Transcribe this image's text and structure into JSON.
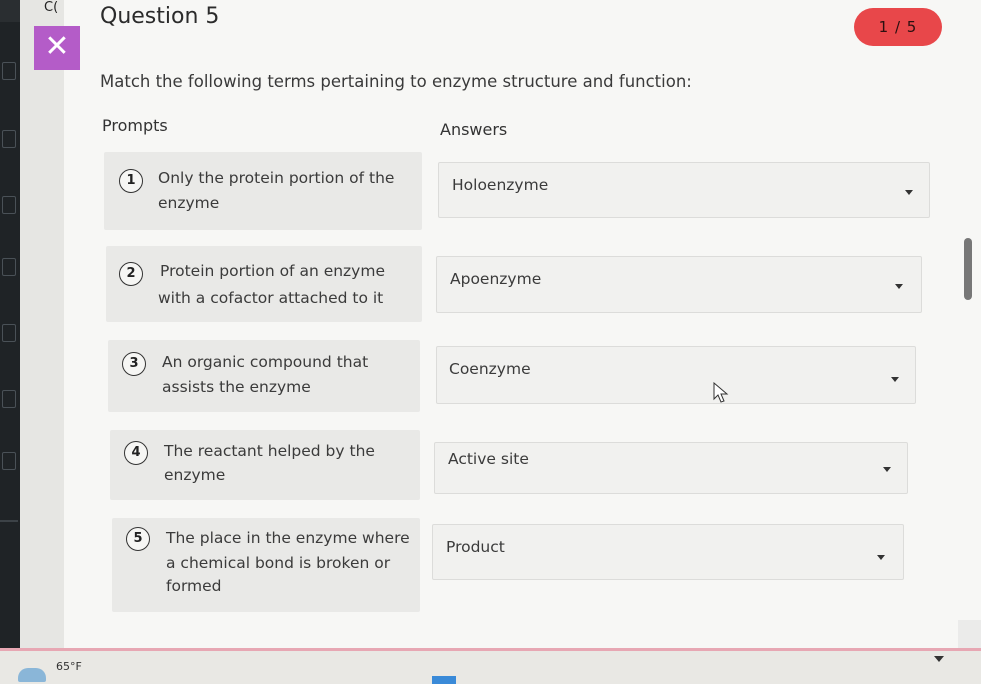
{
  "header": {
    "corner_text": "C(",
    "title": "Question 5",
    "counter": "1 / 5",
    "close_glyph": "✕"
  },
  "instructions": "Match the following terms pertaining to enzyme structure and function:",
  "columns": {
    "prompts": "Prompts",
    "answers": "Answers"
  },
  "prompts": [
    {
      "num": "1",
      "line1": "Only the protein portion of the",
      "line2": "enzyme"
    },
    {
      "num": "2",
      "line1": "Protein portion of an enzyme",
      "line2": "with a cofactor attached to it"
    },
    {
      "num": "3",
      "line1": "An organic compound that",
      "line2": "assists the enzyme"
    },
    {
      "num": "4",
      "line1": "The reactant helped by the",
      "line2": "enzyme"
    },
    {
      "num": "5",
      "line1": "The place in the enzyme where",
      "line2": "a chemical bond is broken or",
      "line3": "formed"
    }
  ],
  "answers": [
    "Holoenzyme",
    "Apoenzyme",
    "Coenzyme",
    "Active site",
    "Product"
  ],
  "taskbar": {
    "temperature": "65°F"
  },
  "icons": {
    "close": "close-icon",
    "dropdown": "chevron-down-icon",
    "weather": "cloud-icon",
    "cursor": "mouse-pointer-icon"
  },
  "colors": {
    "close_bg": "#b45cc8",
    "counter_bg": "#e8474a"
  }
}
